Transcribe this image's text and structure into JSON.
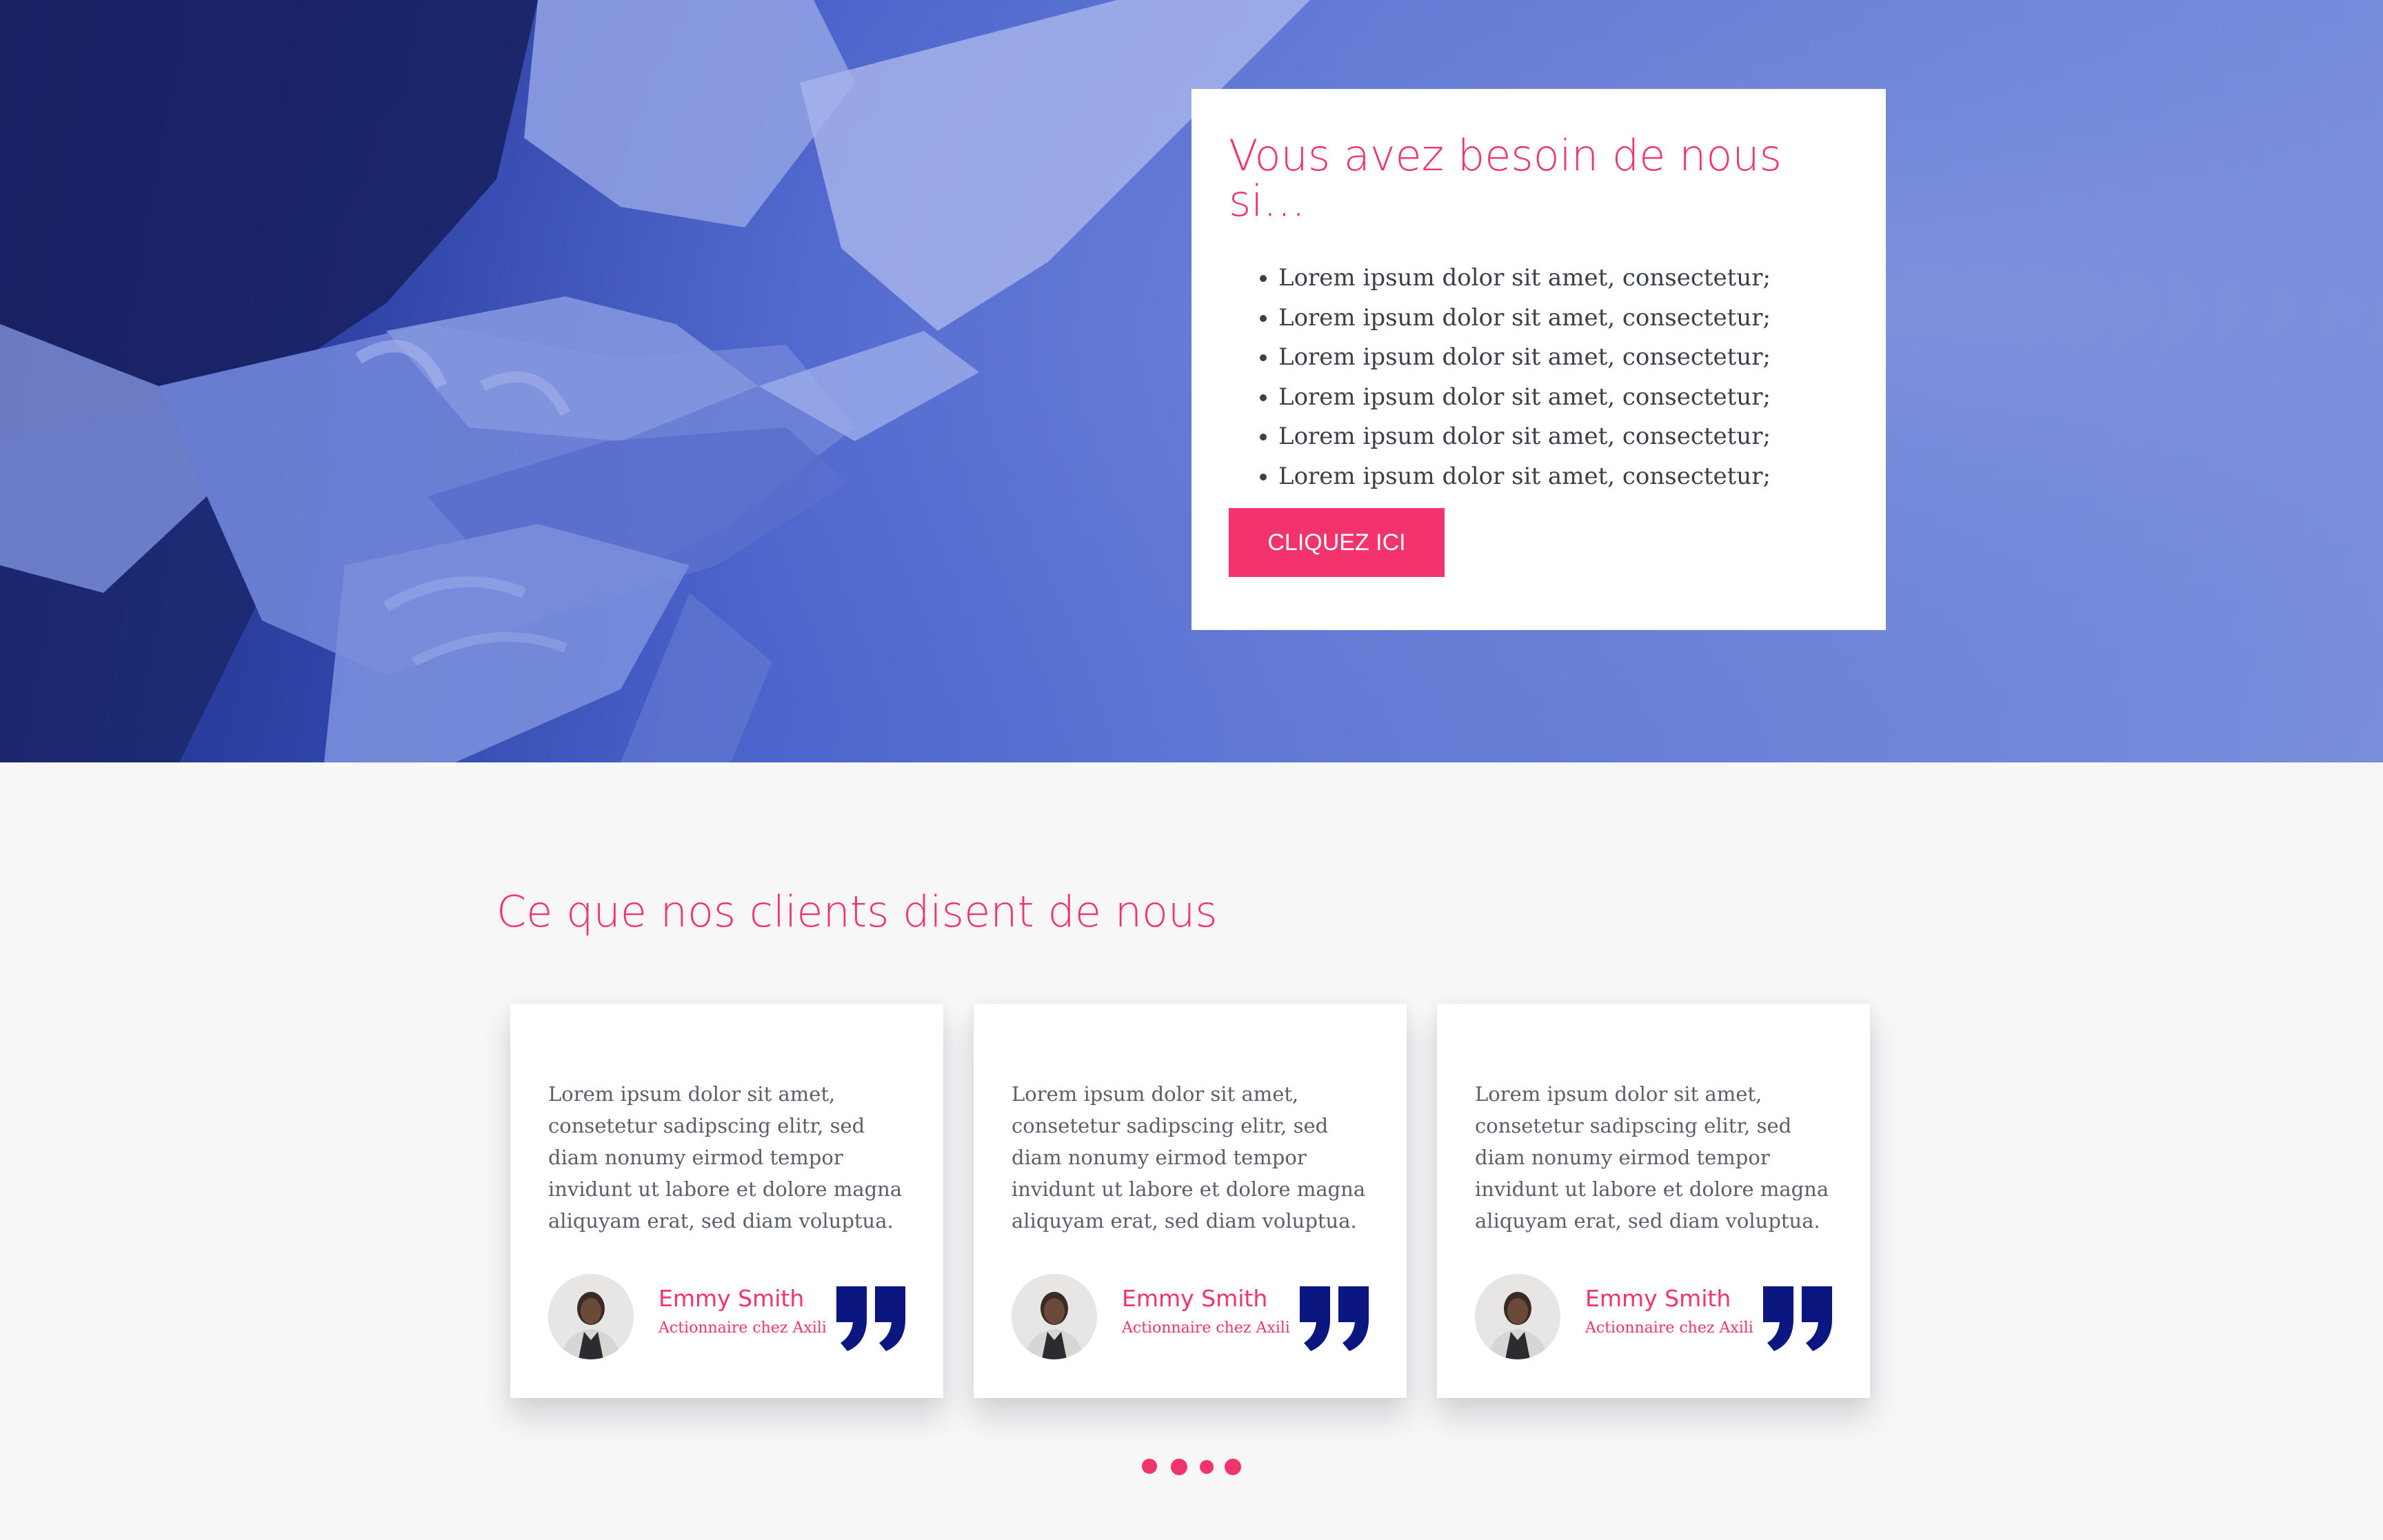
{
  "hero": {
    "title": "Vous avez besoin de nous si…",
    "list_items": [
      "Lorem ipsum dolor sit amet, consectetur;",
      "Lorem ipsum dolor sit amet, consectetur;",
      "Lorem ipsum dolor sit amet, consectetur;",
      "Lorem ipsum dolor sit amet, consectetur;",
      "Lorem ipsum dolor sit amet, consectetur;",
      "Lorem ipsum dolor sit amet, consectetur;"
    ],
    "button_label": "CLIQUEZ ICI"
  },
  "testimonials": {
    "title": "Ce que nos clients disent de nous",
    "cards": [
      {
        "text": "Lorem ipsum dolor sit amet, consetetur sadipscing elitr, sed diam nonumy eirmod tempor invidunt ut labore et dolore magna aliquyam erat, sed diam voluptua.",
        "name": "Emmy Smith",
        "role": "Actionnaire chez Axili",
        "icon": "quote-icon"
      },
      {
        "text": "Lorem ipsum dolor sit amet, consetetur sadipscing elitr, sed diam nonumy eirmod tempor invidunt ut labore et dolore magna aliquyam erat, sed diam voluptua.",
        "name": "Emmy Smith",
        "role": "Actionnaire chez Axili",
        "icon": "quote-icon"
      },
      {
        "text": "Lorem ipsum dolor sit amet, consetetur sadipscing elitr, sed diam nonumy eirmod tempor invidunt ut labore et dolore magna aliquyam erat, sed diam voluptua.",
        "name": "Emmy Smith",
        "role": "Actionnaire chez Axili",
        "icon": "quote-icon"
      }
    ],
    "pagination_dots": 4
  },
  "colors": {
    "accent": "#f2336c",
    "quote_icon": "#0b1680",
    "hero_tint": "#5a72d2",
    "section_bg": "#f7f7f8"
  }
}
